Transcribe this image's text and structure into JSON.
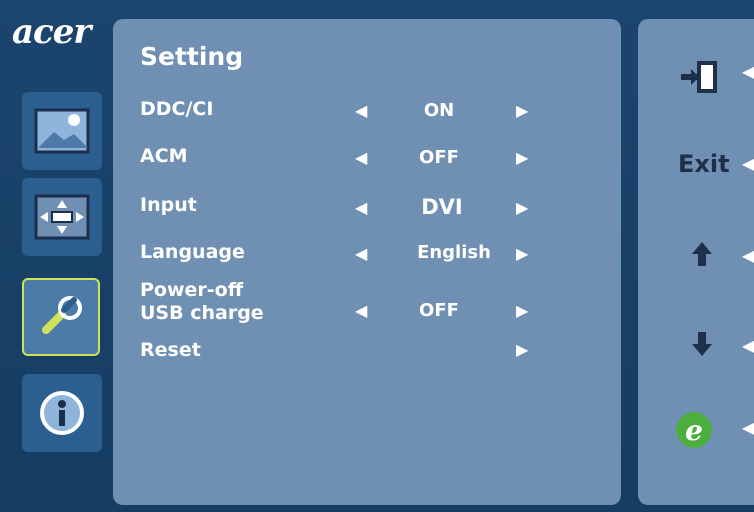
{
  "brand": {
    "logo": "acer"
  },
  "menu": {
    "title": "Setting"
  },
  "rows": [
    {
      "label": "DDC/CI",
      "value": "ON"
    },
    {
      "label": "ACM",
      "value": "OFF"
    },
    {
      "label": "Input",
      "value": "DVI"
    },
    {
      "label": "Language",
      "value": "English"
    },
    {
      "label_line1": "Power-off",
      "label_line2": "USB charge",
      "value": "OFF"
    },
    {
      "label": "Reset"
    }
  ],
  "right_panel": {
    "exit_label": "Exit",
    "e_label": "e"
  },
  "icons": {
    "sidebar": [
      "picture-icon",
      "display-position-icon",
      "wrench-settings-icon",
      "info-icon"
    ],
    "right": [
      "exit-door-icon",
      "exit-text",
      "up-arrow-icon",
      "down-arrow-icon",
      "acer-e-icon"
    ]
  }
}
